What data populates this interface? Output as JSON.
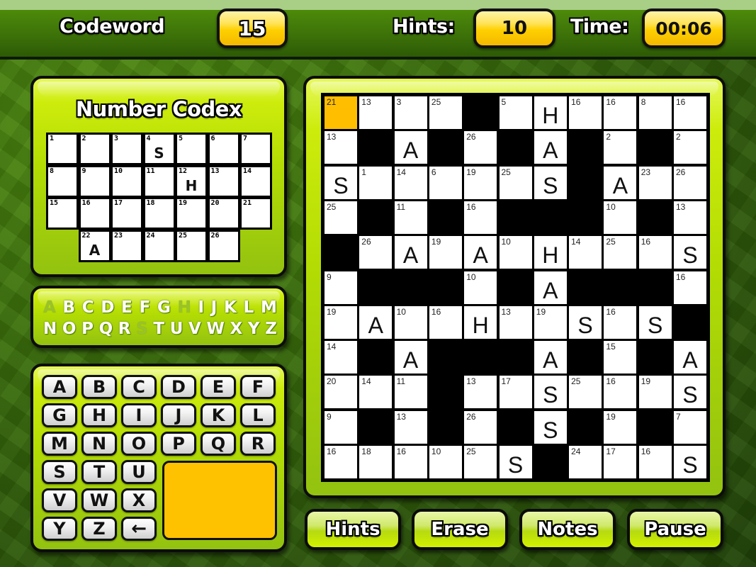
{
  "topbar": {
    "title": "Codeword",
    "puzzle_number": "15",
    "hints_label": "Hints:",
    "hints_value": "10",
    "time_label": "Time:",
    "time_value": "00:06"
  },
  "codex": {
    "title": "Number Codex",
    "cells": [
      {
        "num": "1",
        "letter": ""
      },
      {
        "num": "2",
        "letter": ""
      },
      {
        "num": "3",
        "letter": ""
      },
      {
        "num": "4",
        "letter": "S"
      },
      {
        "num": "5",
        "letter": ""
      },
      {
        "num": "6",
        "letter": ""
      },
      {
        "num": "7",
        "letter": ""
      },
      {
        "num": "8",
        "letter": ""
      },
      {
        "num": "9",
        "letter": ""
      },
      {
        "num": "10",
        "letter": ""
      },
      {
        "num": "11",
        "letter": ""
      },
      {
        "num": "12",
        "letter": "H"
      },
      {
        "num": "13",
        "letter": ""
      },
      {
        "num": "14",
        "letter": ""
      },
      {
        "num": "15",
        "letter": ""
      },
      {
        "num": "16",
        "letter": ""
      },
      {
        "num": "17",
        "letter": ""
      },
      {
        "num": "18",
        "letter": ""
      },
      {
        "num": "19",
        "letter": ""
      },
      {
        "num": "20",
        "letter": ""
      },
      {
        "num": "21",
        "letter": ""
      },
      {
        "num": "22",
        "letter": "A"
      },
      {
        "num": "23",
        "letter": ""
      },
      {
        "num": "24",
        "letter": ""
      },
      {
        "num": "25",
        "letter": ""
      },
      {
        "num": "26",
        "letter": ""
      }
    ]
  },
  "alphabet_status": {
    "row1": [
      "A",
      "B",
      "C",
      "D",
      "E",
      "F",
      "G",
      "H",
      "I",
      "J",
      "K",
      "L",
      "M"
    ],
    "row2": [
      "N",
      "O",
      "P",
      "Q",
      "R",
      "S",
      "T",
      "U",
      "V",
      "W",
      "X",
      "Y",
      "Z"
    ],
    "used_letters": [
      "A",
      "H",
      "S"
    ]
  },
  "keypad": {
    "keys": [
      "A",
      "B",
      "C",
      "D",
      "E",
      "F",
      "G",
      "H",
      "I",
      "J",
      "K",
      "L",
      "M",
      "N",
      "O",
      "P",
      "Q",
      "R",
      "S",
      "T",
      "U",
      "V",
      "W",
      "X",
      "Y",
      "Z"
    ],
    "backspace_label": "←"
  },
  "crossword": {
    "selected": [
      0,
      0
    ],
    "rows": [
      [
        [
          "21",
          ""
        ],
        [
          "13",
          ""
        ],
        [
          "3",
          ""
        ],
        [
          "25",
          ""
        ],
        null,
        [
          "5",
          ""
        ],
        [
          "",
          "H"
        ],
        [
          "16",
          ""
        ],
        [
          "16",
          ""
        ],
        [
          "8",
          ""
        ],
        [
          "16",
          ""
        ]
      ],
      [
        [
          "13",
          ""
        ],
        null,
        [
          "",
          "A"
        ],
        null,
        [
          "26",
          ""
        ],
        null,
        [
          "",
          "A"
        ],
        null,
        [
          "2",
          ""
        ],
        null,
        [
          "2",
          ""
        ]
      ],
      [
        [
          "",
          "S"
        ],
        [
          "1",
          ""
        ],
        [
          "14",
          ""
        ],
        [
          "6",
          ""
        ],
        [
          "19",
          ""
        ],
        [
          "25",
          ""
        ],
        [
          "",
          "S"
        ],
        null,
        [
          "",
          "A"
        ],
        [
          "23",
          ""
        ],
        [
          "26",
          ""
        ]
      ],
      [
        [
          "25",
          ""
        ],
        null,
        [
          "11",
          ""
        ],
        null,
        [
          "16",
          ""
        ],
        null,
        null,
        null,
        [
          "10",
          ""
        ],
        null,
        [
          "13",
          ""
        ]
      ],
      [
        null,
        [
          "26",
          ""
        ],
        [
          "",
          "A"
        ],
        [
          "19",
          ""
        ],
        [
          "",
          "A"
        ],
        [
          "10",
          ""
        ],
        [
          "",
          "H"
        ],
        [
          "14",
          ""
        ],
        [
          "25",
          ""
        ],
        [
          "16",
          ""
        ],
        [
          "",
          "S"
        ]
      ],
      [
        [
          "9",
          ""
        ],
        null,
        null,
        null,
        [
          "10",
          ""
        ],
        null,
        [
          "",
          "A"
        ],
        null,
        null,
        null,
        [
          "16",
          ""
        ]
      ],
      [
        [
          "19",
          ""
        ],
        [
          "",
          "A"
        ],
        [
          "10",
          ""
        ],
        [
          "16",
          ""
        ],
        [
          "",
          "H"
        ],
        [
          "13",
          ""
        ],
        [
          "19",
          ""
        ],
        [
          "",
          "S"
        ],
        [
          "16",
          ""
        ],
        [
          "",
          "S"
        ],
        null
      ],
      [
        [
          "14",
          ""
        ],
        null,
        [
          "",
          "A"
        ],
        null,
        null,
        null,
        [
          "",
          "A"
        ],
        null,
        [
          "15",
          ""
        ],
        null,
        [
          "",
          "A"
        ]
      ],
      [
        [
          "20",
          ""
        ],
        [
          "14",
          ""
        ],
        [
          "11",
          ""
        ],
        null,
        [
          "13",
          ""
        ],
        [
          "17",
          ""
        ],
        [
          "",
          "S"
        ],
        [
          "25",
          ""
        ],
        [
          "16",
          ""
        ],
        [
          "19",
          ""
        ],
        [
          "",
          "S"
        ]
      ],
      [
        [
          "9",
          ""
        ],
        null,
        [
          "13",
          ""
        ],
        null,
        [
          "26",
          ""
        ],
        null,
        [
          "",
          "S"
        ],
        null,
        [
          "19",
          ""
        ],
        null,
        [
          "7",
          ""
        ]
      ],
      [
        [
          "16",
          ""
        ],
        [
          "18",
          ""
        ],
        [
          "16",
          ""
        ],
        [
          "10",
          ""
        ],
        [
          "25",
          ""
        ],
        [
          "",
          "S"
        ],
        null,
        [
          "24",
          ""
        ],
        [
          "17",
          ""
        ],
        [
          "16",
          ""
        ],
        [
          "",
          "S"
        ]
      ]
    ]
  },
  "buttons": {
    "hints": "Hints",
    "erase": "Erase",
    "notes": "Notes",
    "pause": "Pause"
  },
  "colors": {
    "selected_cell": "#ffbe00",
    "panel_lime": "#b3dc04",
    "pill_yellow": "#ffd000"
  }
}
